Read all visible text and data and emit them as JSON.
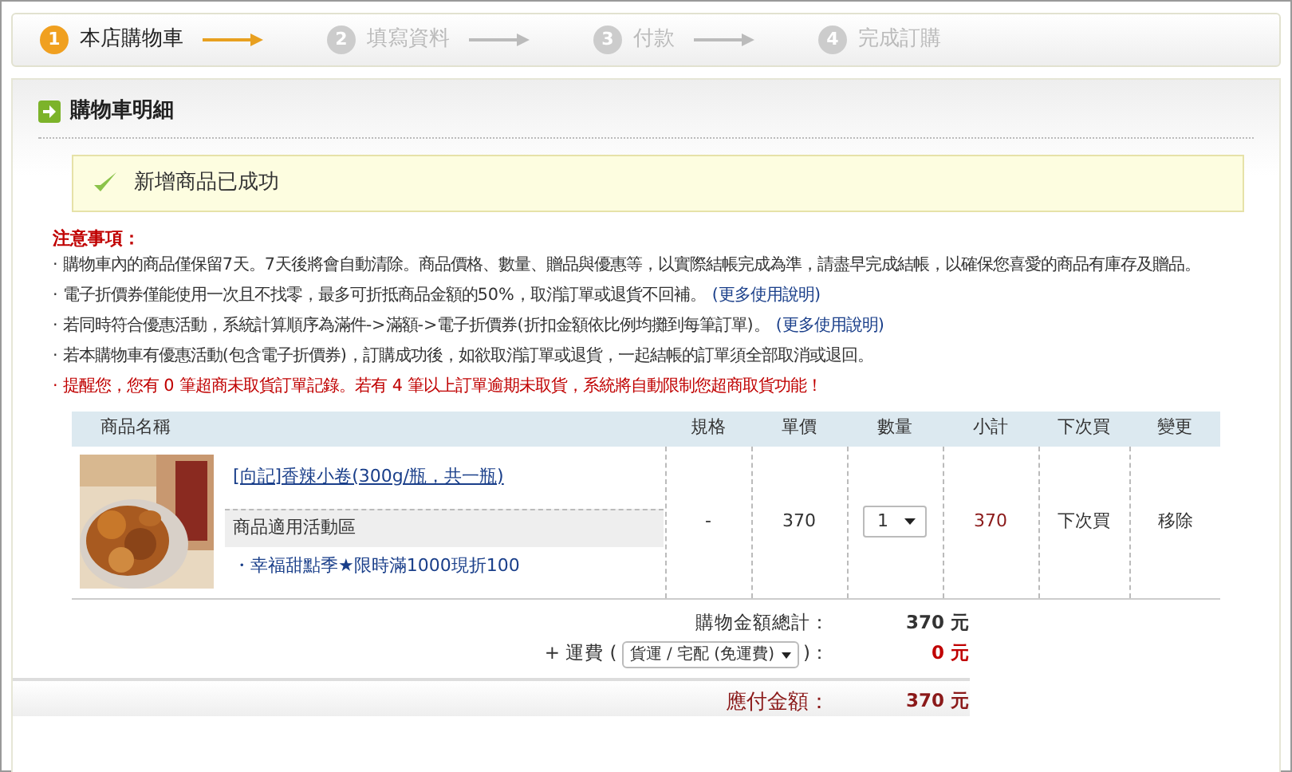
{
  "steps": [
    {
      "number": "1",
      "label": "本店購物車",
      "selected": true
    },
    {
      "number": "2",
      "label": "填寫資料",
      "selected": false
    },
    {
      "number": "3",
      "label": "付款",
      "selected": false
    },
    {
      "number": "4",
      "label": "完成訂購",
      "selected": false
    }
  ],
  "panel": {
    "title": "購物車明細"
  },
  "success_message": "新增商品已成功",
  "notes": {
    "title": "注意事項：",
    "items": [
      {
        "kind": "plain",
        "bullet": "·",
        "text": "購物車內的商品僅保留7天。7天後將會自動清除。商品價格、數量、贈品與優惠等，以實際結帳完成為準，請盡早完成結帳，以確保您喜愛的商品有庫存及贈品。"
      },
      {
        "kind": "plain",
        "bullet": "·",
        "text": "電子折價券僅能使用一次且不找零，最多可折抵商品金額的50%，取消訂單或退貨不回補。",
        "link": "(更多使用說明)"
      },
      {
        "kind": "plain",
        "bullet": "·",
        "text": "若同時符合優惠活動，系統計算順序為滿件->滿額->電子折價券(折扣金額依比例均攤到每筆訂單)。",
        "link": "(更多使用說明)"
      },
      {
        "kind": "plain",
        "bullet": "·",
        "text": "若本購物車有優惠活動(包含電子折價券)，訂購成功後，如欲取消訂單或退貨，一起結帳的訂單須全部取消或退回。"
      },
      {
        "kind": "warning",
        "bullet": "·",
        "text": "提醒您，您有 0 筆超商未取貨訂單記錄。若有 4 筆以上訂單逾期未取貨，系統將自動限制您超商取貨功能！"
      }
    ]
  },
  "table": {
    "columns": [
      "商品名稱",
      "規格",
      "單價",
      "數量",
      "小計",
      "下次買",
      "變更"
    ],
    "rows": [
      {
        "name": "[向記]香辣小卷(300g/瓶，共一瓶)",
        "promo_heading": "商品適用活動區",
        "promo": "・幸福甜點季★限時滿1000現折100",
        "spec": "-",
        "price": "370",
        "quantity": "1",
        "subtotal": "370",
        "buy_later": "下次買",
        "remove": "移除"
      }
    ]
  },
  "totals": {
    "subtotal_label": "購物金額總計：",
    "subtotal": "370 元",
    "shipping_prefix": "+ 運費 (",
    "shipping_option": "貨運 / 宅配 (免運費)",
    "shipping_suffix": ")：",
    "shipping": "0 元",
    "total_label": "應付金額：",
    "total": "370 元"
  }
}
